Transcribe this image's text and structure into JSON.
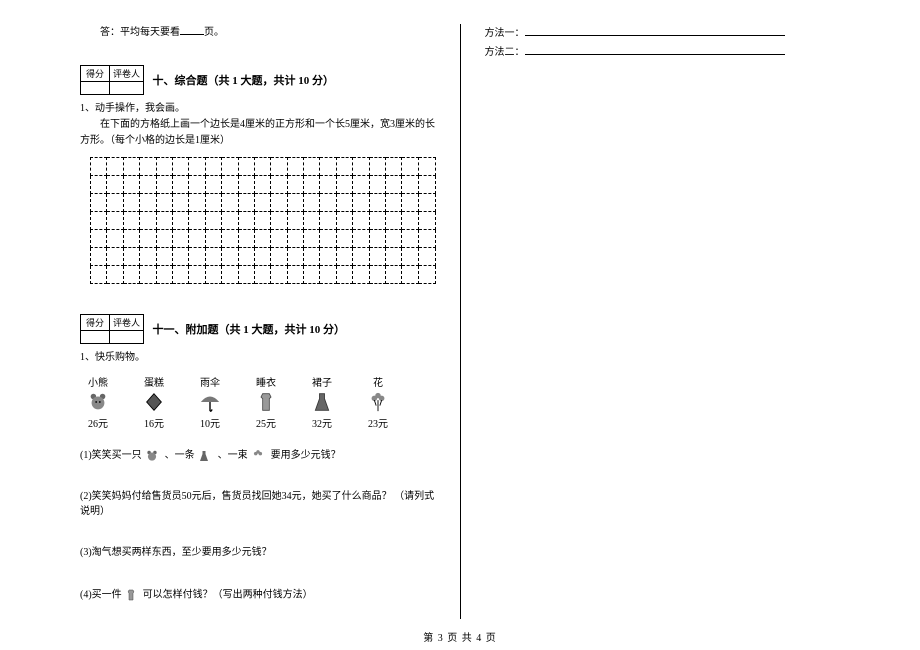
{
  "left": {
    "answer_prefix": "答：平均每天要看",
    "answer_suffix": "页。",
    "score_labels": {
      "score": "得分",
      "grader": "评卷人"
    },
    "sec10": {
      "title": "十、综合题（共 1 大题，共计 10 分）",
      "q1_label": "1、动手操作，我会画。",
      "q1_body": "在下面的方格纸上画一个边长是4厘米的正方形和一个长5厘米，宽3厘米的长方形。（每个小格的边长是1厘米）"
    },
    "sec11": {
      "title": "十一、附加题（共 1 大题，共计 10 分）",
      "q1_label": "1、快乐购物。",
      "items": [
        {
          "name": "小熊",
          "price": "26元"
        },
        {
          "name": "蛋糕",
          "price": "16元"
        },
        {
          "name": "雨伞",
          "price": "10元"
        },
        {
          "name": "睡衣",
          "price": "25元"
        },
        {
          "name": "裙子",
          "price": "32元"
        },
        {
          "name": "花",
          "price": "23元"
        }
      ],
      "sub1_a": "(1)笑笑买一只",
      "sub1_b": "、一条",
      "sub1_c": "、一束",
      "sub1_d": "要用多少元钱？",
      "sub2": "(2)笑笑妈妈付给售货员50元后，售货员找回她34元，她买了什么商品？  （请列式说明）",
      "sub3": "(3)淘气想买两样东西，至少要用多少元钱？",
      "sub4_a": "(4)买一件",
      "sub4_b": "可以怎样付钱？（写出两种付钱方法）"
    }
  },
  "right": {
    "method1": "方法一：",
    "method2": "方法二："
  },
  "footer": "第 3 页 共 4 页"
}
